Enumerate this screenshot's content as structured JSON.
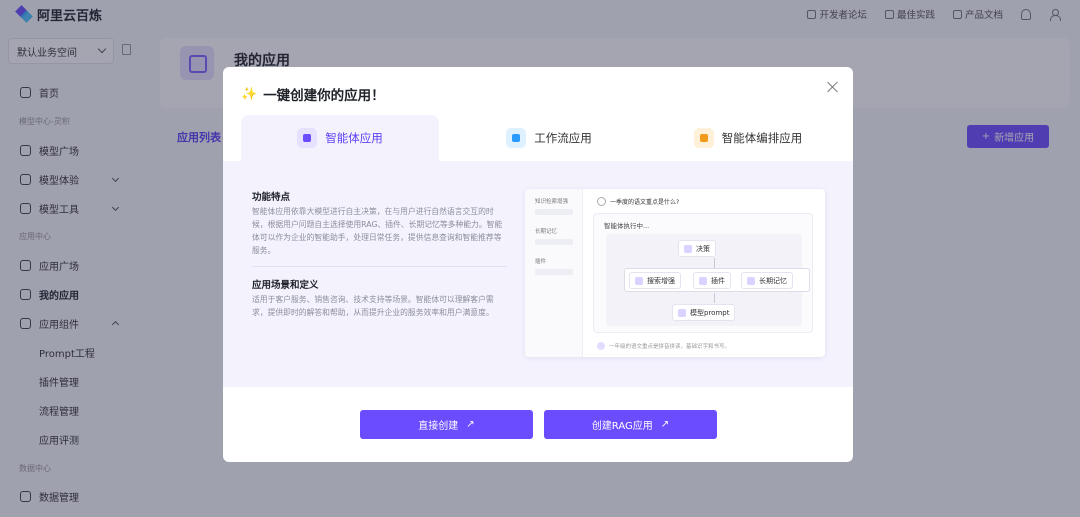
{
  "brand": {
    "name": "阿里云百炼"
  },
  "top_links": [
    {
      "label": "开发者论坛",
      "icon": "forum-icon"
    },
    {
      "label": "最佳实践",
      "icon": "practice-icon"
    },
    {
      "label": "产品文档",
      "icon": "doc-icon"
    }
  ],
  "sidebar": {
    "workspace": "默认业务空间",
    "items": [
      {
        "type": "item",
        "label": "首页"
      },
      {
        "type": "group",
        "label": "模型中心-灵积"
      },
      {
        "type": "item",
        "label": "模型广场"
      },
      {
        "type": "item",
        "label": "模型体验",
        "arrow": "down"
      },
      {
        "type": "item",
        "label": "模型工具",
        "arrow": "down"
      },
      {
        "type": "group",
        "label": "应用中心"
      },
      {
        "type": "item",
        "label": "应用广场"
      },
      {
        "type": "item",
        "label": "我的应用",
        "active": true
      },
      {
        "type": "item",
        "label": "应用组件",
        "arrow": "up"
      },
      {
        "type": "sub",
        "label": "Prompt工程"
      },
      {
        "type": "sub",
        "label": "插件管理"
      },
      {
        "type": "sub",
        "label": "流程管理"
      },
      {
        "type": "sub",
        "label": "应用评测"
      },
      {
        "type": "group",
        "label": "数据中心"
      },
      {
        "type": "item",
        "label": "数据管理"
      }
    ]
  },
  "main": {
    "title": "我的应用",
    "tab_app_list": "应用列表",
    "new_app_button": "新增应用"
  },
  "modal": {
    "title": "一键创建你的应用！",
    "tabs": [
      {
        "label": "智能体应用",
        "icon": "agent-icon",
        "active": true
      },
      {
        "label": "工作流应用",
        "icon": "workflow-icon"
      },
      {
        "label": "智能体编排应用",
        "icon": "orchestration-icon"
      }
    ],
    "features_title": "功能特点",
    "features_desc": "智能体应用依靠大模型进行自主决策，在与用户进行自然语言交互的时候，根据用户问题自主选择使用RAG、插件、长期记忆等多种能力。智能体可以作为企业的智能助手，处理日常任务，提供信息查询和智能推荐等服务。",
    "scenario_title": "应用场景和定义",
    "scenario_desc": "适用于客户服务、销售咨询、技术支持等场景。智能体可以理解客户需求，提供即时的解答和帮助，从而提升企业的服务效率和用户满意度。",
    "preview": {
      "side_items": [
        "知识检索增强",
        "长期记忆",
        "插件"
      ],
      "question": "一季度的语文重点是什么?",
      "executing": "智能体执行中...",
      "decision": "决策",
      "tools": [
        "搜索增强",
        "插件",
        "长期记忆"
      ],
      "model": "模型prompt",
      "footer": "一年级的语文重点是拼音拼读，基础识字和书写。"
    },
    "buttons": {
      "direct": "直接创建",
      "rag": "创建RAG应用"
    }
  }
}
